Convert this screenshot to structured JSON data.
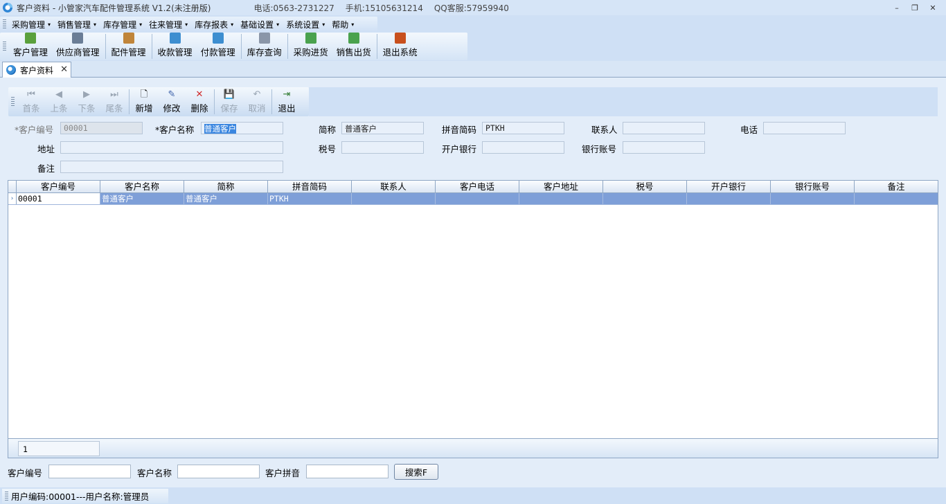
{
  "window": {
    "title": "客户资料 - 小管家汽车配件管理系统 V1.2(未注册版)",
    "phone": "电话:0563-2731227",
    "mobile": "手机:15105631214",
    "qq": "QQ客服:57959940",
    "minimize": "–",
    "maximize": "❐",
    "close": "✕"
  },
  "menubar": {
    "items": [
      {
        "label": "采购管理"
      },
      {
        "label": "销售管理"
      },
      {
        "label": "库存管理"
      },
      {
        "label": "往来管理"
      },
      {
        "label": "库存报表"
      },
      {
        "label": "基础设置"
      },
      {
        "label": "系统设置"
      },
      {
        "label": "帮助"
      }
    ],
    "caret": "▾"
  },
  "toolbar": {
    "items": [
      {
        "label": "客户管理",
        "icon": "customer-icon",
        "color": "#5aa03c"
      },
      {
        "label": "供应商管理",
        "icon": "supplier-icon",
        "color": "#6a7d96"
      },
      {
        "label": "配件管理",
        "icon": "parts-icon",
        "color": "#c0853a"
      },
      {
        "label": "收款管理",
        "icon": "receipt-icon",
        "color": "#3d8ed0"
      },
      {
        "label": "付款管理",
        "icon": "payment-icon",
        "color": "#3d8ed0"
      },
      {
        "label": "库存查询",
        "icon": "inventory-search-icon",
        "color": "#8a96a8"
      },
      {
        "label": "采购进货",
        "icon": "purchase-in-icon",
        "color": "#4aa24e"
      },
      {
        "label": "销售出货",
        "icon": "sales-out-icon",
        "color": "#4aa24e"
      },
      {
        "label": "退出系统",
        "icon": "exit-system-icon",
        "color": "#c8501e"
      }
    ]
  },
  "tab": {
    "label": "客户资料",
    "close": "✕"
  },
  "record_toolbar": {
    "first": {
      "label": "首条",
      "icon": "⏮"
    },
    "prev": {
      "label": "上条",
      "icon": "◀"
    },
    "next": {
      "label": "下条",
      "icon": "▶"
    },
    "last": {
      "label": "尾条",
      "icon": "⏭"
    },
    "add": {
      "label": "新增",
      "icon": "🗋"
    },
    "edit": {
      "label": "修改",
      "icon": "✎"
    },
    "delete": {
      "label": "删除",
      "icon": "✕"
    },
    "save": {
      "label": "保存",
      "icon": "💾"
    },
    "cancel": {
      "label": "取消",
      "icon": "↶"
    },
    "exit": {
      "label": "退出",
      "icon": "⇥"
    }
  },
  "form": {
    "customer_code": {
      "label": "*客户编号",
      "value": "00001"
    },
    "customer_name": {
      "label": "*客户名称",
      "value": "普通客户"
    },
    "short_name": {
      "label": "简称",
      "value": "普通客户"
    },
    "pinyin": {
      "label": "拼音简码",
      "value": "PTKH"
    },
    "contact": {
      "label": "联系人",
      "value": ""
    },
    "phone": {
      "label": "电话",
      "value": ""
    },
    "address": {
      "label": "地址",
      "value": ""
    },
    "tax_no": {
      "label": "税号",
      "value": ""
    },
    "bank": {
      "label": "开户银行",
      "value": ""
    },
    "bank_account": {
      "label": "银行账号",
      "value": ""
    },
    "remark": {
      "label": "备注",
      "value": ""
    }
  },
  "grid": {
    "columns": [
      "客户编号",
      "客户名称",
      "简称",
      "拼音简码",
      "联系人",
      "客户电话",
      "客户地址",
      "税号",
      "开户银行",
      "银行账号",
      "备注"
    ],
    "rows": [
      [
        "00001",
        "普通客户",
        "普通客户",
        "PTKH",
        "",
        "",
        "",
        "",
        "",
        "",
        ""
      ]
    ],
    "row_indicator": "›",
    "selected_row_color": "#7e9fd8"
  },
  "pager": {
    "value": "1"
  },
  "search": {
    "code_label": "客户编号",
    "name_label": "客户名称",
    "pinyin_label": "客户拼音",
    "button": "搜索F"
  },
  "statusbar": {
    "text": "用户编码:00001---用户名称:管理员"
  }
}
